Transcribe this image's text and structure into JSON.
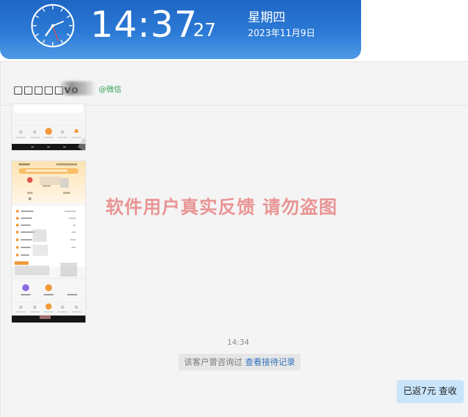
{
  "clock": {
    "time_hm": "14:37",
    "seconds": "27",
    "weekday": "星期四",
    "date": "2023年11月9日"
  },
  "chat": {
    "contact_name": "□□□□□vo",
    "contact_source": "@微信",
    "watermark": "软件用户真实反馈  请勿盗图",
    "timestamp": "14:34",
    "system_notice": "该客户曾咨询过",
    "system_link": "查看接待记录",
    "message": "已返7元  查收"
  },
  "colors": {
    "clock_bg_top": "#1f66c4",
    "clock_bg_bottom": "#4f9ae6",
    "watermark": "#e88a8a",
    "source_green": "#3aa559",
    "link_blue": "#2f6fbf",
    "bubble_blue": "#c9e5fb",
    "phone_accent_orange": "#f39a3a"
  }
}
